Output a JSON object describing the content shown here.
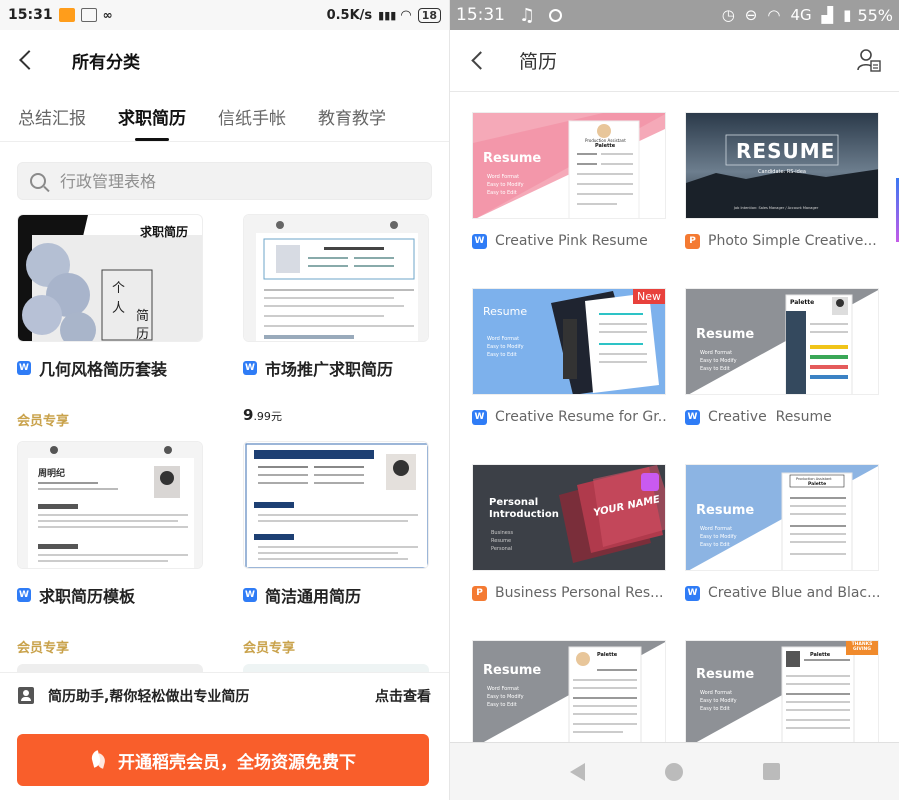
{
  "left": {
    "status": {
      "time": "15:31",
      "speed": "0.5K/s",
      "battery": "18"
    },
    "header": {
      "title": "所有分类"
    },
    "tabs": [
      "总结汇报",
      "求职简历",
      "信纸手帐",
      "教育教学"
    ],
    "active_tab": 1,
    "search": {
      "placeholder": "行政管理表格"
    },
    "cards": [
      {
        "name": "几何风格简历套装",
        "tag": "会员专享",
        "thumb_text": "求职简历",
        "thumb_vertical": [
          "个",
          "人",
          "简",
          "历"
        ]
      },
      {
        "name": "市场推广求职简历",
        "price_int": "9",
        "price_dec": ".99",
        "price_unit": "元"
      },
      {
        "name": "求职简历模板",
        "tag": "会员专享",
        "thumb_name": "周明纪"
      },
      {
        "name": "简洁通用简历",
        "tag": "会员专享"
      }
    ],
    "tip": {
      "label": "简历助手,帮你轻松做出专业简历",
      "link": "点击查看"
    },
    "cta": "开通稻壳会员，全场资源免费下"
  },
  "right": {
    "status": {
      "time": "15:31",
      "network": "4G",
      "battery": "55%"
    },
    "header": {
      "title": "简历"
    },
    "cards": [
      {
        "name": "Creative Pink Resume",
        "icon": "W",
        "thumb": "pink",
        "resume_word": "Resume",
        "bullets": [
          "Word Format",
          "Easy to Modify",
          "Easy to Edit"
        ],
        "paper_title": "Production Assistant",
        "paper_name": "Palette"
      },
      {
        "name": "Photo Simple Creative...",
        "icon": "P",
        "thumb": "photo",
        "resume_word": "RESUME",
        "sub": "Candidate: RS-idea",
        "sub2": "Job Intention: Sales Manager / Account Manager"
      },
      {
        "name": "Creative Resume for Gr...",
        "icon": "W",
        "thumb": "blue",
        "resume_word": "Resume",
        "badge": "New",
        "bullets": [
          "Word Format",
          "Easy to Modify",
          "Easy to Edit"
        ]
      },
      {
        "name": "Creative  Resume",
        "icon": "W",
        "thumb": "gray",
        "resume_word": "Resume",
        "bullets": [
          "Word Format",
          "Easy to Modify",
          "Easy to Edit"
        ],
        "paper_name": "Palette"
      },
      {
        "name": "Business Personal Res...",
        "icon": "P",
        "thumb": "personal",
        "resume_word": "Personal Introduction",
        "bullets": [
          "Business",
          "Resume",
          "Personal"
        ],
        "card_text": "YOUR NAME"
      },
      {
        "name": "Creative Blue and Blac...",
        "icon": "W",
        "thumb": "bluewhite",
        "resume_word": "Resume",
        "bullets": [
          "Word Format",
          "Easy to Modify",
          "Easy to Edit"
        ],
        "paper_title": "Production Assistant",
        "paper_name": "Palette"
      },
      {
        "name": "",
        "icon": "",
        "thumb": "gray2",
        "resume_word": "Resume",
        "bullets": [
          "Word Format",
          "Easy to Modify",
          "Easy to Edit"
        ],
        "paper_name": "Palette"
      },
      {
        "name": "",
        "icon": "",
        "thumb": "gray3",
        "resume_word": "Resume",
        "bullets": [
          "Word Format",
          "Easy to Modify",
          "Easy to Edit"
        ],
        "badge": "THANKS GIVING",
        "paper_name": "Palette"
      }
    ]
  },
  "colors": {
    "accent_orange": "#f95e2b",
    "member_gold": "#c9a24b",
    "word_blue": "#2f7cf6",
    "ppt_orange": "#f47a32",
    "new_red": "#e8413c"
  }
}
